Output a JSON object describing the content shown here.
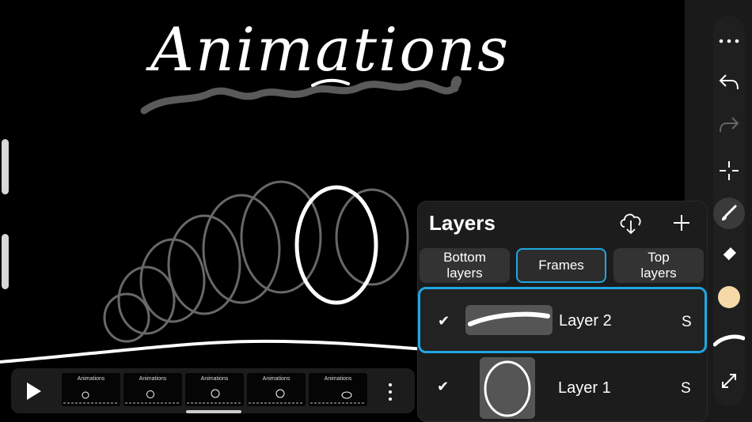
{
  "canvas": {
    "title_text": "Animations"
  },
  "toolbar": {
    "tools": [
      "more-icon",
      "undo-icon",
      "redo-icon",
      "transform-icon",
      "brush-icon",
      "eraser-icon",
      "color-swatch",
      "brush-size-icon",
      "fullscreen-icon"
    ],
    "active_tool": "brush-icon",
    "current_color": "#f5d9a8"
  },
  "layers_panel": {
    "title": "Layers",
    "buttons": {
      "bottom_layers": "Bottom layers",
      "frames": "Frames",
      "top_layers": "Top layers"
    },
    "active_button": "frames",
    "layers": [
      {
        "name": "Layer 2",
        "visible_mark": "✔",
        "suffix": "S",
        "selected": true
      },
      {
        "name": "Layer 1",
        "visible_mark": "✔",
        "suffix": "S",
        "selected": false
      }
    ]
  },
  "timeline": {
    "frame_labels": [
      "Animations",
      "Animations",
      "Animations",
      "Animations",
      "Animations"
    ]
  },
  "colors": {
    "accent": "#1fa6e0",
    "panel": "#1c1c1c"
  }
}
